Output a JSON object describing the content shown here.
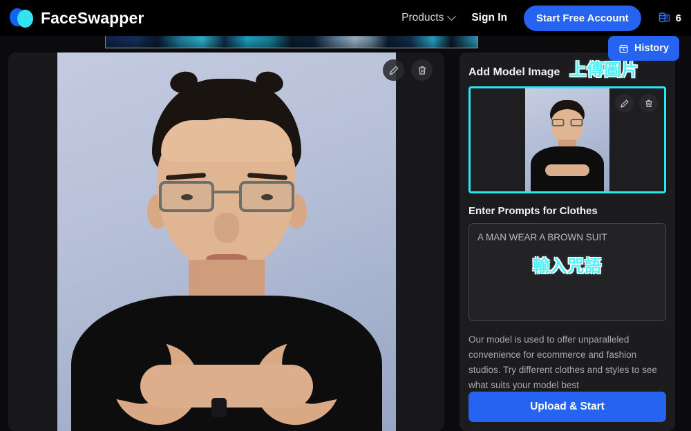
{
  "header": {
    "brand_name": "FaceSwapper",
    "logo_blue": "#1364f4",
    "logo_cyan": "#35e2f0",
    "nav": {
      "products_label": "Products",
      "signin_label": "Sign In",
      "cta_label": "Start Free Account",
      "credits_count": "6",
      "credits_icon": "coin-stack-icon"
    },
    "accent_color": "#2563f0"
  },
  "history": {
    "label": "History",
    "icon": "calendar-history-icon"
  },
  "preview": {
    "edit_icon": "pencil-icon",
    "delete_icon": "trash-icon"
  },
  "sidebar": {
    "add_model_title": "Add Model Image",
    "add_model_accent": "上傳圖片",
    "accent_color": "#4ef2f8",
    "thumbnail": {
      "border_color": "#27e8f2",
      "edit_icon": "pencil-icon",
      "delete_icon": "trash-icon"
    },
    "prompts_title": "Enter Prompts for Clothes",
    "prompt_value": "A MAN WEAR A BROWN SUIT",
    "prompt_accent": "輸入咒語",
    "description": "Our model is used to offer unparalleled convenience for ecommerce and fashion studios. Try different clothes and styles to see what suits your model best",
    "start_label": "Upload & Start"
  }
}
